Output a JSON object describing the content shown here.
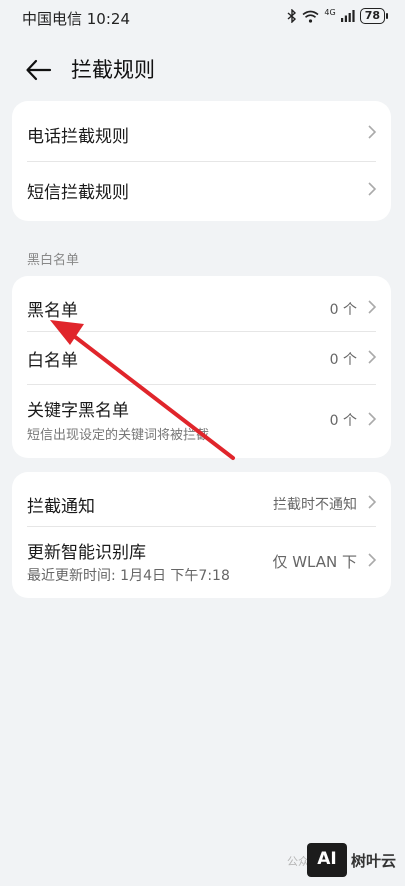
{
  "status_bar": {
    "carrier_time": "中国电信 10:24",
    "network": "4G",
    "battery": "78"
  },
  "header": {
    "title": "拦截规则"
  },
  "rules_card": {
    "items": [
      {
        "label": "电话拦截规则"
      },
      {
        "label": "短信拦截规则"
      }
    ]
  },
  "blackwhite_section": {
    "label": "黑白名单",
    "items": [
      {
        "label": "黑名单",
        "value": "0 个"
      },
      {
        "label": "白名单",
        "value": "0 个"
      },
      {
        "label": "关键字黑名单",
        "subtitle": "短信出现设定的关键词将被拦截",
        "value": "0 个"
      }
    ]
  },
  "settings_card": {
    "items": [
      {
        "label": "拦截通知",
        "value": "拦截时不通知"
      },
      {
        "label": "更新智能识别库",
        "subtitle": "最近更新时间: 1月4日 下午7:18",
        "value": "仅 WLAN 下"
      }
    ]
  },
  "annotation": {
    "color": "#e0252b"
  },
  "watermark": {
    "prefix": "公众",
    "logo": "AI",
    "brand": "树叶云"
  }
}
